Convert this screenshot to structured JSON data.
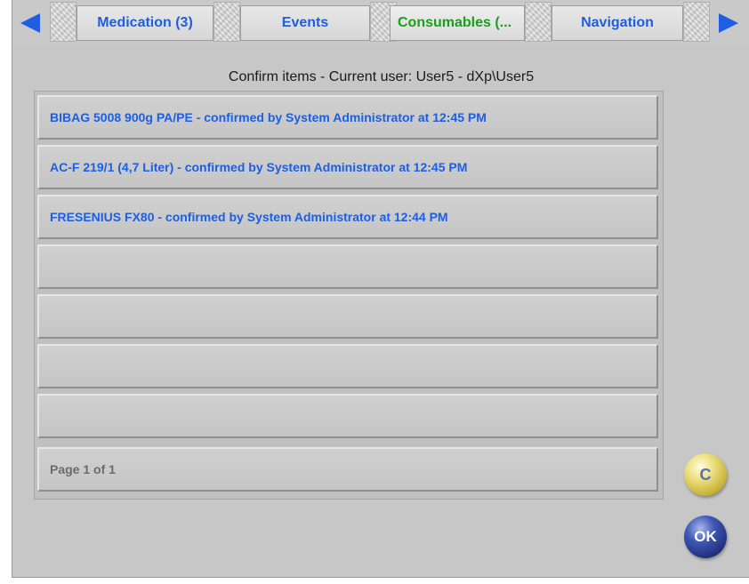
{
  "tabs": [
    {
      "label": "Medication (3)",
      "active": false
    },
    {
      "label": "Events",
      "active": false
    },
    {
      "label": "Consumables (...",
      "active": true
    },
    {
      "label": "Navigation",
      "active": false
    }
  ],
  "heading": "Confirm items - Current user: User5 - dXp\\User5",
  "rows": [
    "BIBAG 5008 900g PA/PE - confirmed by System Administrator at 12:45 PM",
    "AC-F 219/1 (4,7 Liter) - confirmed by System Administrator at 12:45 PM",
    "FRESENIUS FX80 - confirmed by System Administrator at 12:44 PM",
    "",
    "",
    "",
    ""
  ],
  "footer": "Page 1 of 1",
  "buttons": {
    "cancel_label": "C",
    "ok_label": "OK"
  },
  "colors": {
    "accent": "#1d5fe0",
    "active_tab": "#18a018",
    "panel": "#c7c7c7"
  },
  "icons": {
    "scroll_left": "left-triangle-arrow",
    "scroll_right": "right-triangle-arrow"
  }
}
